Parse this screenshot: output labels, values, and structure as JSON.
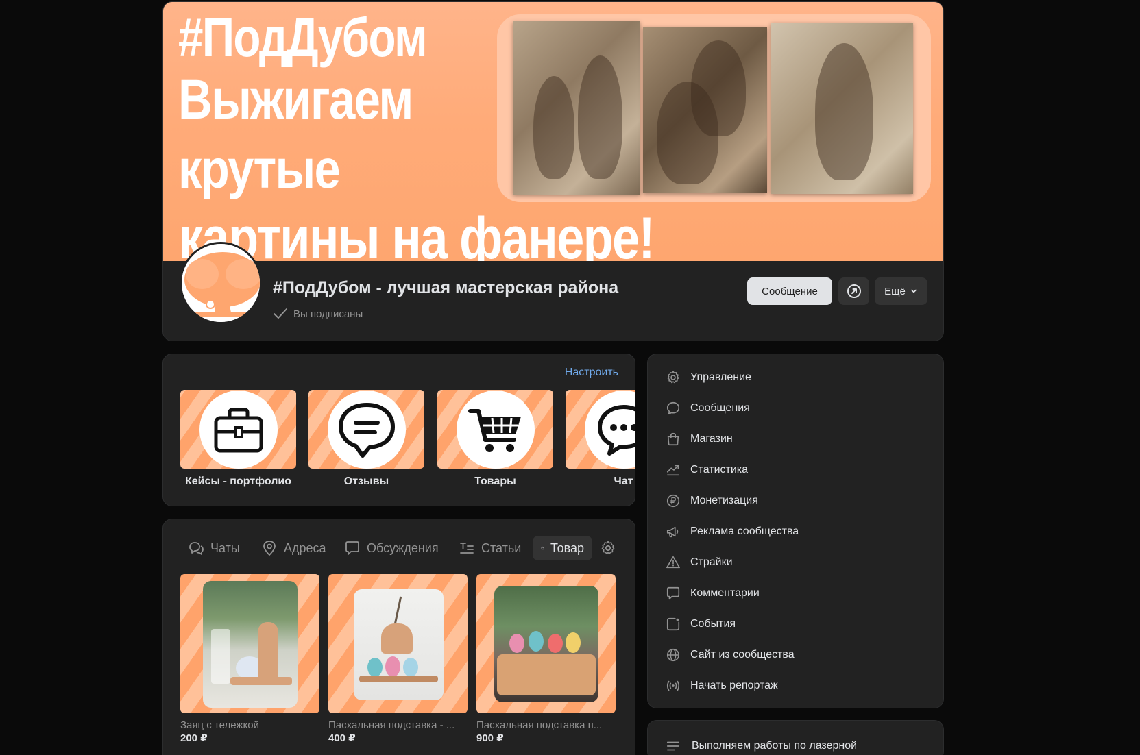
{
  "cover": {
    "lines": [
      "#ПодДубом",
      "Выжигаем",
      "крутые",
      "картины на фанере!"
    ]
  },
  "group": {
    "name": "#ПодДубом - лучшая мастерская района",
    "subscribed_label": "Вы подписаны",
    "message_button": "Сообщение",
    "more_button": "Ещё"
  },
  "links": {
    "customize_label": "Настроить",
    "items": [
      {
        "label": "Кейсы - портфолио",
        "icon": "toolbox-icon"
      },
      {
        "label": "Отзывы",
        "icon": "chat-bubble-icon"
      },
      {
        "label": "Товары",
        "icon": "shopping-cart-icon"
      },
      {
        "label": "Чат",
        "icon": "chat-dots-icon"
      }
    ]
  },
  "tabs": [
    {
      "label": "Чаты",
      "icon": "chats-icon"
    },
    {
      "label": "Адреса",
      "icon": "location-pin-icon"
    },
    {
      "label": "Обсуждения",
      "icon": "discussion-icon"
    },
    {
      "label": "Статьи",
      "icon": "articles-icon"
    },
    {
      "label": "Товар",
      "icon": "shopping-bag-icon",
      "active": true
    }
  ],
  "products": [
    {
      "name": "Заяц с тележкой",
      "price": "200 ₽"
    },
    {
      "name": "Пасхальная подставка - ...",
      "price": "400 ₽"
    },
    {
      "name": "Пасхальная подставка п...",
      "price": "900 ₽"
    }
  ],
  "menu": [
    {
      "label": "Управление",
      "icon": "gear-icon"
    },
    {
      "label": "Сообщения",
      "icon": "message-icon"
    },
    {
      "label": "Магазин",
      "icon": "shopping-bag-icon"
    },
    {
      "label": "Статистика",
      "icon": "statistics-icon"
    },
    {
      "label": "Монетизация",
      "icon": "ruble-icon"
    },
    {
      "label": "Реклама сообщества",
      "icon": "megaphone-icon"
    },
    {
      "label": "Страйки",
      "icon": "warning-icon"
    },
    {
      "label": "Комментарии",
      "icon": "comment-icon"
    },
    {
      "label": "События",
      "icon": "events-icon"
    },
    {
      "label": "Сайт из сообщества",
      "icon": "globe-icon"
    },
    {
      "label": "Начать репортаж",
      "icon": "broadcast-icon"
    }
  ],
  "about": {
    "text": "Выполняем работы по лазерной"
  },
  "colors": {
    "accent_link": "#71aaeb",
    "cover_orange": "#fea66f",
    "card_bg": "#222222",
    "page_bg": "#0a0a0a"
  }
}
